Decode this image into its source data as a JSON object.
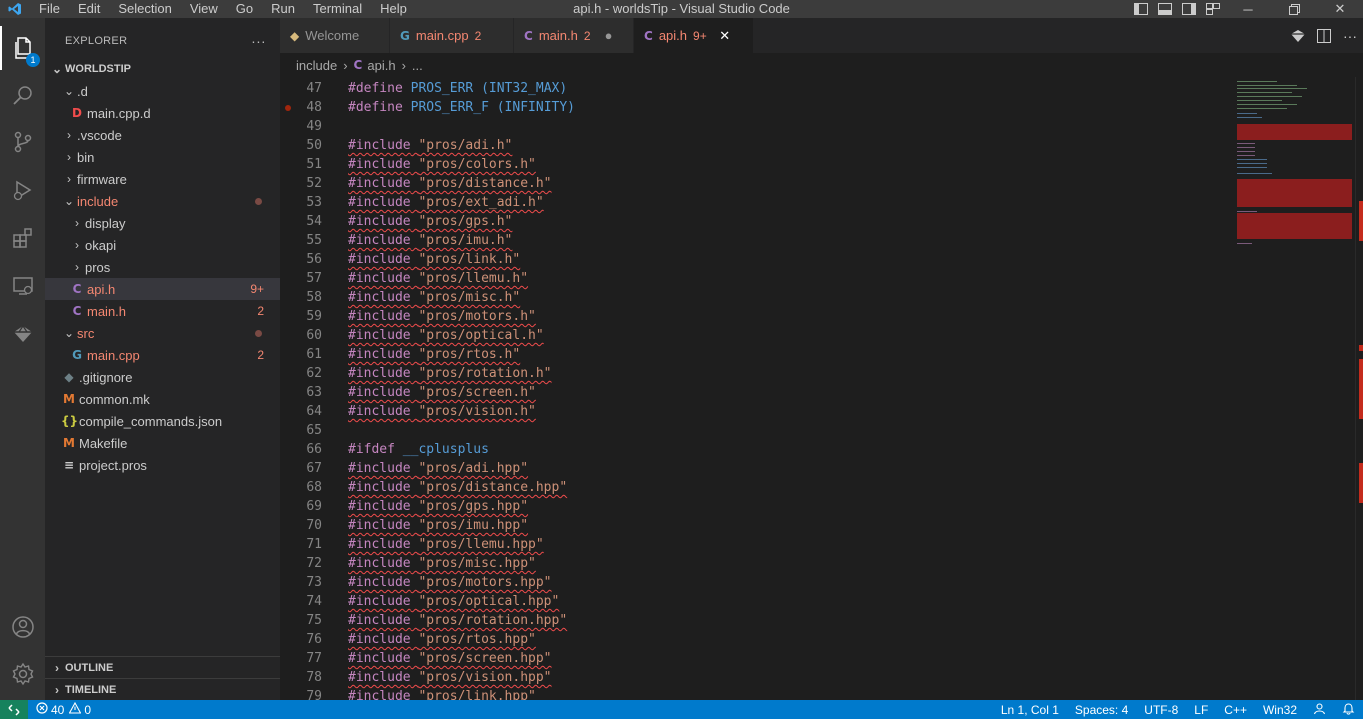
{
  "titlebar": {
    "menu": [
      "File",
      "Edit",
      "Selection",
      "View",
      "Go",
      "Run",
      "Terminal",
      "Help"
    ],
    "title": "api.h - worldsTip - Visual Studio Code"
  },
  "activity": {
    "explorer_badge": "1"
  },
  "sidebar": {
    "header": "EXPLORER",
    "more": "···",
    "workspace": "WORLDSTIP",
    "tree": [
      {
        "label": ".d",
        "indent": 1,
        "chevron": "⌄"
      },
      {
        "label": "main.cpp.d",
        "indent": 2,
        "icon": "D",
        "icon_color": "#f14c4c"
      },
      {
        "label": ".vscode",
        "indent": 1,
        "chevron": "›"
      },
      {
        "label": "bin",
        "indent": 1,
        "chevron": "›"
      },
      {
        "label": "firmware",
        "indent": 1,
        "chevron": "›"
      },
      {
        "label": "include",
        "indent": 1,
        "chevron": "⌄",
        "error": true,
        "dot": true
      },
      {
        "label": "display",
        "indent": 2,
        "chevron": "›"
      },
      {
        "label": "okapi",
        "indent": 2,
        "chevron": "›"
      },
      {
        "label": "pros",
        "indent": 2,
        "chevron": "›"
      },
      {
        "label": "api.h",
        "indent": 2,
        "icon": "C",
        "icon_color": "#a074c4",
        "error": true,
        "badge": "9+",
        "selected": true
      },
      {
        "label": "main.h",
        "indent": 2,
        "icon": "C",
        "icon_color": "#a074c4",
        "error": true,
        "badge": "2"
      },
      {
        "label": "src",
        "indent": 1,
        "chevron": "⌄",
        "error": true,
        "dot": true
      },
      {
        "label": "main.cpp",
        "indent": 2,
        "icon": "G",
        "icon_color": "#519aba",
        "error": true,
        "badge": "2"
      },
      {
        "label": ".gitignore",
        "indent": 1,
        "icon": "◆",
        "icon_color": "#6d8086"
      },
      {
        "label": "common.mk",
        "indent": 1,
        "icon": "M",
        "icon_color": "#e37933"
      },
      {
        "label": "compile_commands.json",
        "indent": 1,
        "icon": "{}",
        "icon_color": "#cbcb41"
      },
      {
        "label": "Makefile",
        "indent": 1,
        "icon": "M",
        "icon_color": "#e37933"
      },
      {
        "label": "project.pros",
        "indent": 1,
        "icon": "≡",
        "icon_color": "#cccccc"
      }
    ],
    "outline": "OUTLINE",
    "timeline": "TIMELINE"
  },
  "tabs": [
    {
      "label": "Welcome",
      "icon": "◆",
      "icon_color": "#d7ba7d",
      "error": false,
      "badge": "",
      "close": ""
    },
    {
      "label": "main.cpp",
      "icon": "G",
      "icon_color": "#519aba",
      "error": true,
      "badge": "2",
      "close": ""
    },
    {
      "label": "main.h",
      "icon": "C",
      "icon_color": "#a074c4",
      "error": true,
      "badge": "2",
      "close": "●"
    },
    {
      "label": "api.h",
      "icon": "C",
      "icon_color": "#a074c4",
      "error": true,
      "badge": "9+",
      "close": "✕",
      "active": true
    }
  ],
  "breadcrumb": {
    "folder": "include",
    "file": "api.h",
    "more": "..."
  },
  "code": [
    {
      "n": "47",
      "t": "define",
      "name": "PROS_ERR",
      "val": "(INT32_MAX)"
    },
    {
      "n": "48",
      "t": "define",
      "name": "PROS_ERR_F",
      "val": "(INFINITY)",
      "bp": true
    },
    {
      "n": "49",
      "t": "blank"
    },
    {
      "n": "50",
      "t": "include",
      "path": "\"pros/adi.h\""
    },
    {
      "n": "51",
      "t": "include",
      "path": "\"pros/colors.h\""
    },
    {
      "n": "52",
      "t": "include",
      "path": "\"pros/distance.h\""
    },
    {
      "n": "53",
      "t": "include",
      "path": "\"pros/ext_adi.h\""
    },
    {
      "n": "54",
      "t": "include",
      "path": "\"pros/gps.h\""
    },
    {
      "n": "55",
      "t": "include",
      "path": "\"pros/imu.h\""
    },
    {
      "n": "56",
      "t": "include",
      "path": "\"pros/link.h\""
    },
    {
      "n": "57",
      "t": "include",
      "path": "\"pros/llemu.h\""
    },
    {
      "n": "58",
      "t": "include",
      "path": "\"pros/misc.h\""
    },
    {
      "n": "59",
      "t": "include",
      "path": "\"pros/motors.h\""
    },
    {
      "n": "60",
      "t": "include",
      "path": "\"pros/optical.h\""
    },
    {
      "n": "61",
      "t": "include",
      "path": "\"pros/rtos.h\""
    },
    {
      "n": "62",
      "t": "include",
      "path": "\"pros/rotation.h\""
    },
    {
      "n": "63",
      "t": "include",
      "path": "\"pros/screen.h\""
    },
    {
      "n": "64",
      "t": "include",
      "path": "\"pros/vision.h\""
    },
    {
      "n": "65",
      "t": "blank"
    },
    {
      "n": "66",
      "t": "ifdef",
      "name": "__cplusplus"
    },
    {
      "n": "67",
      "t": "include",
      "path": "\"pros/adi.hpp\""
    },
    {
      "n": "68",
      "t": "include",
      "path": "\"pros/distance.hpp\""
    },
    {
      "n": "69",
      "t": "include",
      "path": "\"pros/gps.hpp\""
    },
    {
      "n": "70",
      "t": "include",
      "path": "\"pros/imu.hpp\""
    },
    {
      "n": "71",
      "t": "include",
      "path": "\"pros/llemu.hpp\""
    },
    {
      "n": "72",
      "t": "include",
      "path": "\"pros/misc.hpp\""
    },
    {
      "n": "73",
      "t": "include",
      "path": "\"pros/motors.hpp\""
    },
    {
      "n": "74",
      "t": "include",
      "path": "\"pros/optical.hpp\""
    },
    {
      "n": "75",
      "t": "include",
      "path": "\"pros/rotation.hpp\""
    },
    {
      "n": "76",
      "t": "include",
      "path": "\"pros/rtos.hpp\""
    },
    {
      "n": "77",
      "t": "include",
      "path": "\"pros/screen.hpp\""
    },
    {
      "n": "78",
      "t": "include",
      "path": "\"pros/vision.hpp\""
    },
    {
      "n": "79",
      "t": "include",
      "path": "\"pros/link.hpp\""
    }
  ],
  "statusbar": {
    "errors": "40",
    "warnings": "0",
    "position": "Ln 1, Col 1",
    "spaces": "Spaces: 4",
    "encoding": "UTF-8",
    "eol": "LF",
    "language": "C++",
    "platform": "Win32"
  },
  "colors": {
    "accent": "#007acc",
    "error": "#f48771",
    "keyword": "#c586c0",
    "string": "#ce9178",
    "macro": "#569cd6"
  }
}
